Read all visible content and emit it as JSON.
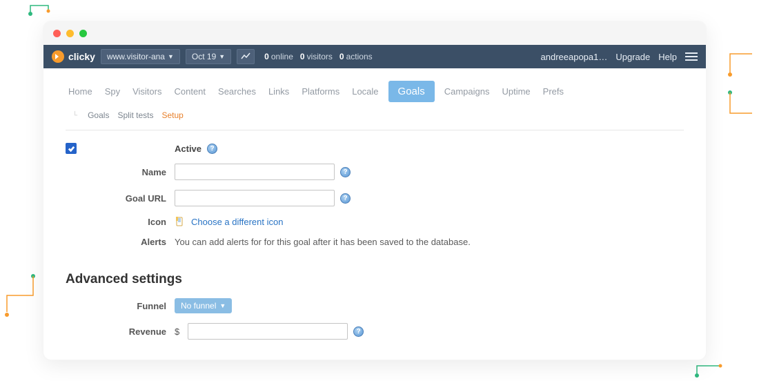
{
  "brand": "clicky",
  "site_selector": "www.visitor-ana",
  "date_selector": "Oct 19",
  "stats": {
    "online": {
      "value": "0",
      "label": "online"
    },
    "visitors": {
      "value": "0",
      "label": "visitors"
    },
    "actions": {
      "value": "0",
      "label": "actions"
    }
  },
  "user": "andreeapopa1…",
  "nav_upgrade": "Upgrade",
  "nav_help": "Help",
  "tabs": {
    "home": "Home",
    "spy": "Spy",
    "visitors": "Visitors",
    "content": "Content",
    "searches": "Searches",
    "links": "Links",
    "platforms": "Platforms",
    "locale": "Locale",
    "goals": "Goals",
    "campaigns": "Campaigns",
    "uptime": "Uptime",
    "prefs": "Prefs"
  },
  "subtabs": {
    "goals": "Goals",
    "split": "Split tests",
    "setup": "Setup"
  },
  "form": {
    "active_label": "Active",
    "active_checked": true,
    "name_label": "Name",
    "name_value": "",
    "goalurl_label": "Goal URL",
    "goalurl_value": "",
    "icon_label": "Icon",
    "icon_link": "Choose a different icon",
    "alerts_label": "Alerts",
    "alerts_text": "You can add alerts for for this goal after it has been saved to the database."
  },
  "advanced": {
    "heading": "Advanced settings",
    "funnel_label": "Funnel",
    "funnel_value": "No funnel",
    "revenue_label": "Revenue",
    "revenue_prefix": "$",
    "revenue_value": ""
  }
}
